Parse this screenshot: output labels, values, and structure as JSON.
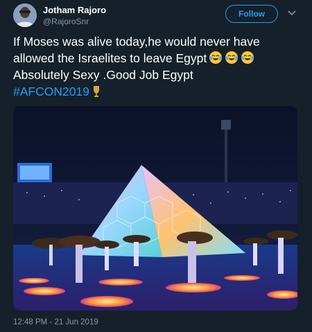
{
  "user": {
    "display_name": "Jotham Rajoro",
    "handle": "@RajoroSnr"
  },
  "actions": {
    "follow_label": "Follow",
    "menu_icon": "chevron-down-icon"
  },
  "tweet": {
    "line1": "If Moses was alive today,he would never have",
    "line2": "allowed the Israelites to leave Egypt",
    "line2_emojis": [
      "face-with-tears-of-joy",
      "face-with-tears-of-joy",
      "face-with-tears-of-joy"
    ],
    "line3": "Absolutely Sexy .Good Job Egypt",
    "hashtag": "#AFCON2019",
    "hashtag_emoji": "trophy-icon",
    "timestamp": "12:48 PM - 21 Jun 2019"
  },
  "media": {
    "type": "photo",
    "subject": "stadium-pyramid-projection"
  },
  "colors": {
    "background": "#15202b",
    "accent": "#1da1f2",
    "secondary_text": "#8899a6"
  }
}
